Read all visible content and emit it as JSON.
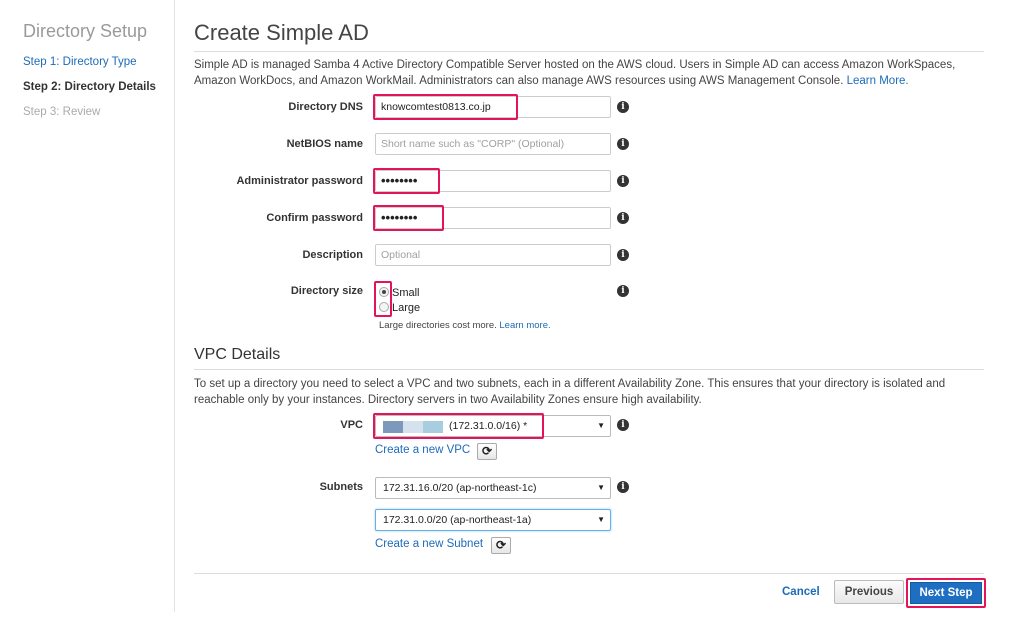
{
  "sidebar": {
    "title": "Directory Setup",
    "steps": [
      {
        "label": "Step 1: Directory Type"
      },
      {
        "label": "Step 2: Directory Details"
      },
      {
        "label": "Step 3: Review"
      }
    ]
  },
  "main": {
    "title": "Create Simple AD",
    "intro": "Simple AD is managed Samba 4 Active Directory Compatible Server hosted on the AWS cloud. Users in Simple AD can access Amazon WorkSpaces, Amazon WorkDocs, and Amazon WorkMail. Administrators can also manage AWS resources using AWS Management Console.",
    "intro_link": "Learn More.",
    "fields": {
      "dns": {
        "label": "Directory DNS",
        "value": "knowcomtest0813.co.jp"
      },
      "netbios": {
        "label": "NetBIOS name",
        "placeholder": "Short name such as \"CORP\" (Optional)"
      },
      "admin_password": {
        "label": "Administrator password",
        "value": "••••••••"
      },
      "confirm_password": {
        "label": "Confirm password",
        "value": "••••••••"
      },
      "description": {
        "label": "Description",
        "placeholder": "Optional"
      },
      "size": {
        "label": "Directory size",
        "options": [
          {
            "label": "Small",
            "checked": true
          },
          {
            "label": "Large",
            "checked": false
          }
        ],
        "hint": "Large directories cost more.",
        "hint_link": "Learn more."
      }
    }
  },
  "vpc": {
    "title": "VPC Details",
    "intro": "To set up a directory you need to select a VPC and two subnets, each in a different Availability Zone. This ensures that your directory is isolated and reachable only by your instances. Directory servers in two Availability Zones ensure high availability.",
    "vpc_label": "VPC",
    "vpc_value": "(172.31.0.0/16) *",
    "vpc_redaction_colors": [
      "#7c99bb",
      "#d6e1ee",
      "#a9cde0"
    ],
    "create_vpc_link": "Create a new VPC",
    "subnets_label": "Subnets",
    "subnet1": "172.31.16.0/20 (ap-northeast-1c)",
    "subnet2": "172.31.0.0/20 (ap-northeast-1a)",
    "create_subnet_link": "Create a new Subnet"
  },
  "footer": {
    "cancel": "Cancel",
    "previous": "Previous",
    "next": "Next Step"
  },
  "icons": {
    "info": "i",
    "refresh": "⟳",
    "caret": "▼"
  },
  "colors": {
    "link": "#1d6bb8",
    "primary_button": "#1e6fc2",
    "highlight": "#e3145c"
  }
}
